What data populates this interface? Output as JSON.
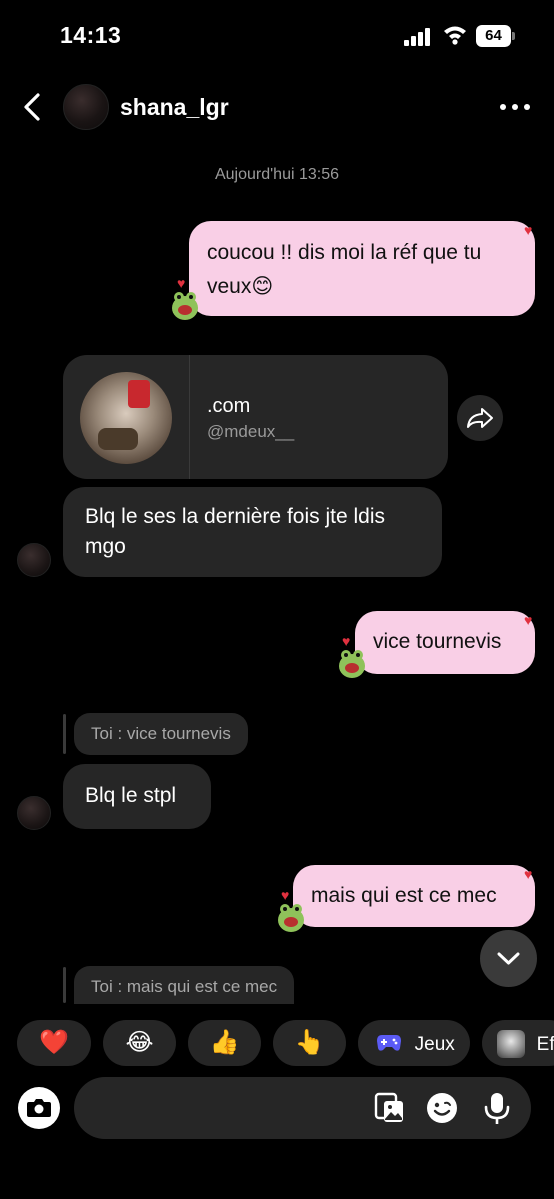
{
  "status_bar": {
    "time": "14:13",
    "battery": "64"
  },
  "header": {
    "username": "shana_lgr"
  },
  "conversation": {
    "timestamp": "Aujourd'hui 13:56",
    "messages": [
      {
        "side": "out",
        "lines": [
          "coucou !! dis moi la réf que tu",
          "veux😊"
        ]
      },
      {
        "side": "in",
        "type": "profile_share",
        "title": ".com",
        "handle": "@mdeux__"
      },
      {
        "side": "in",
        "lines": [
          "Blq le ses la dernière fois jte ldis",
          "mgo"
        ]
      },
      {
        "side": "out",
        "lines": [
          "vice tournevis"
        ]
      },
      {
        "side": "in",
        "reply_to": "Toi : vice tournevis",
        "lines": [
          "Blq le stpl"
        ]
      },
      {
        "side": "out",
        "lines": [
          "mais qui est ce mec"
        ]
      },
      {
        "side": "in",
        "reply_to": "Toi : mais qui est ce mec"
      }
    ]
  },
  "quick_reactions": [
    {
      "icon": "heart",
      "glyph": "❤️"
    },
    {
      "icon": "joy",
      "glyph": "😂"
    },
    {
      "icon": "thumbs-up",
      "glyph": "👍"
    },
    {
      "icon": "pointing-hand",
      "glyph": "👆"
    },
    {
      "icon": "gamepad",
      "label": "Jeux"
    },
    {
      "icon": "effect-avatar",
      "label": "Eff"
    }
  ],
  "colors": {
    "background": "#000000",
    "outgoing_bubble": "#f9cfe6",
    "incoming_bubble": "#262626",
    "heart": "#e0313f",
    "game_icon": "#5b5bf5"
  }
}
